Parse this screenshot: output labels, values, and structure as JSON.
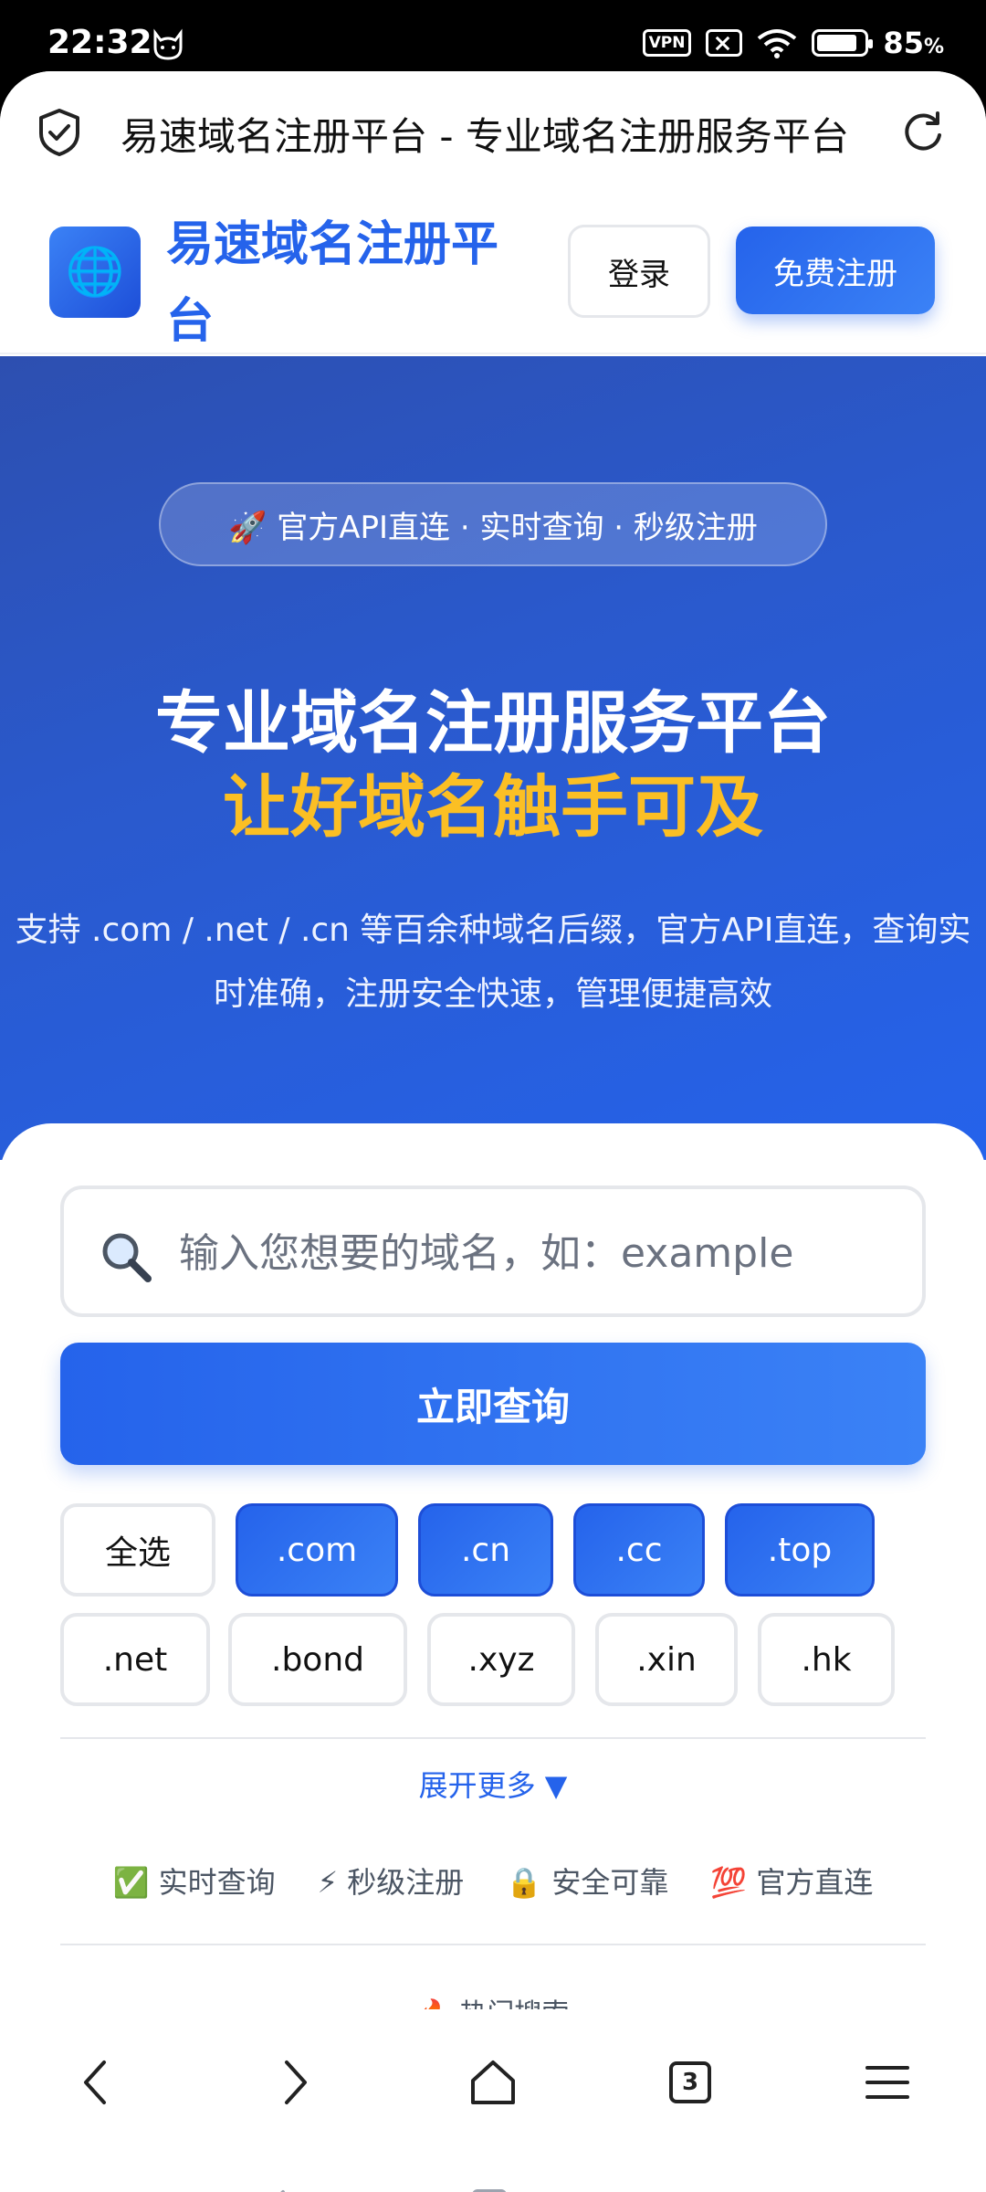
{
  "status_bar": {
    "time": "22:32",
    "vpn": "VPN",
    "battery_percent": "85",
    "battery_level": 0.85,
    "icons": [
      "cat-icon",
      "vpn-icon",
      "sim-off-icon",
      "wifi-icon",
      "battery-icon"
    ]
  },
  "browser": {
    "page_title": "易速域名注册平台 - 专业域名注册服务平台",
    "tab_count": "3"
  },
  "header": {
    "logo_icon": "🌐",
    "site_name": "易速域名注册平台",
    "login_label": "登录",
    "register_label": "免费注册"
  },
  "hero": {
    "pill_text": "🚀 官方API直连 · 实时查询 · 秒级注册",
    "title": "专业域名注册服务平台",
    "subtitle": "让好域名触手可及",
    "description": "支持 .com / .net / .cn 等百余种域名后缀，官方API直连，查询实时准确，注册安全快速，管理便捷高效",
    "subtitle_color": "#fbbf24"
  },
  "search": {
    "placeholder": "输入您想要的域名，如：example",
    "button_label": "立即查询"
  },
  "tlds": {
    "row1": [
      {
        "label": "全选",
        "selected": false
      },
      {
        "label": ".com",
        "selected": true
      },
      {
        "label": ".cn",
        "selected": true
      },
      {
        "label": ".cc",
        "selected": true
      },
      {
        "label": ".top",
        "selected": true
      }
    ],
    "row2": [
      {
        "label": ".net",
        "selected": false
      },
      {
        "label": ".bond",
        "selected": false
      },
      {
        "label": ".xyz",
        "selected": false
      },
      {
        "label": ".xin",
        "selected": false
      },
      {
        "label": ".hk",
        "selected": false
      }
    ]
  },
  "expand_label": "展开更多 ▼",
  "features": [
    {
      "icon": "✅",
      "label": "实时查询"
    },
    {
      "icon": "⚡",
      "label": "秒级注册"
    },
    {
      "icon": "🔒",
      "label": "安全可靠"
    },
    {
      "icon": "💯",
      "label": "官方直连"
    }
  ],
  "hot_search": "🔥 热门搜索",
  "colors": {
    "brand_blue": "#2563eb",
    "hero_gradient_start": "#2d4fb0",
    "accent_yellow": "#fbbf24"
  }
}
